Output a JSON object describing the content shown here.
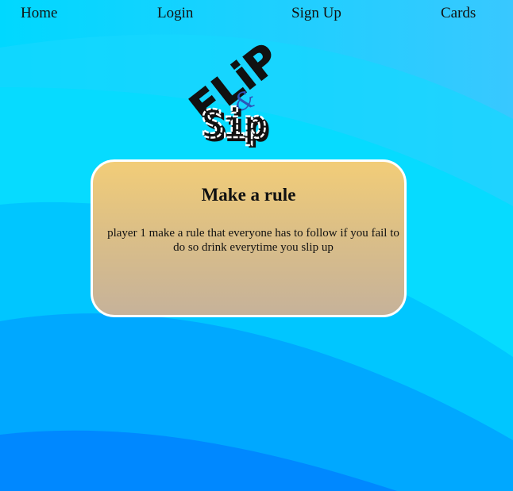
{
  "colors": {
    "background_light": "#22ccff",
    "background_mid": "#00b4ff",
    "background_dark": "#0088ff",
    "card_top": "#f2cd78",
    "card_bottom": "#c6b29a",
    "card_border": "#ffffff"
  },
  "nav": {
    "home": "Home",
    "login": "Login",
    "signup": "Sign Up",
    "cards": "Cards"
  },
  "logo": {
    "line1": "FLiP",
    "ampersand": "&",
    "line2": "Sip"
  },
  "card": {
    "title": "Make a rule",
    "text": "player 1 make a rule that everyone has to follow if you fail to do so drink everytime you slip up"
  }
}
